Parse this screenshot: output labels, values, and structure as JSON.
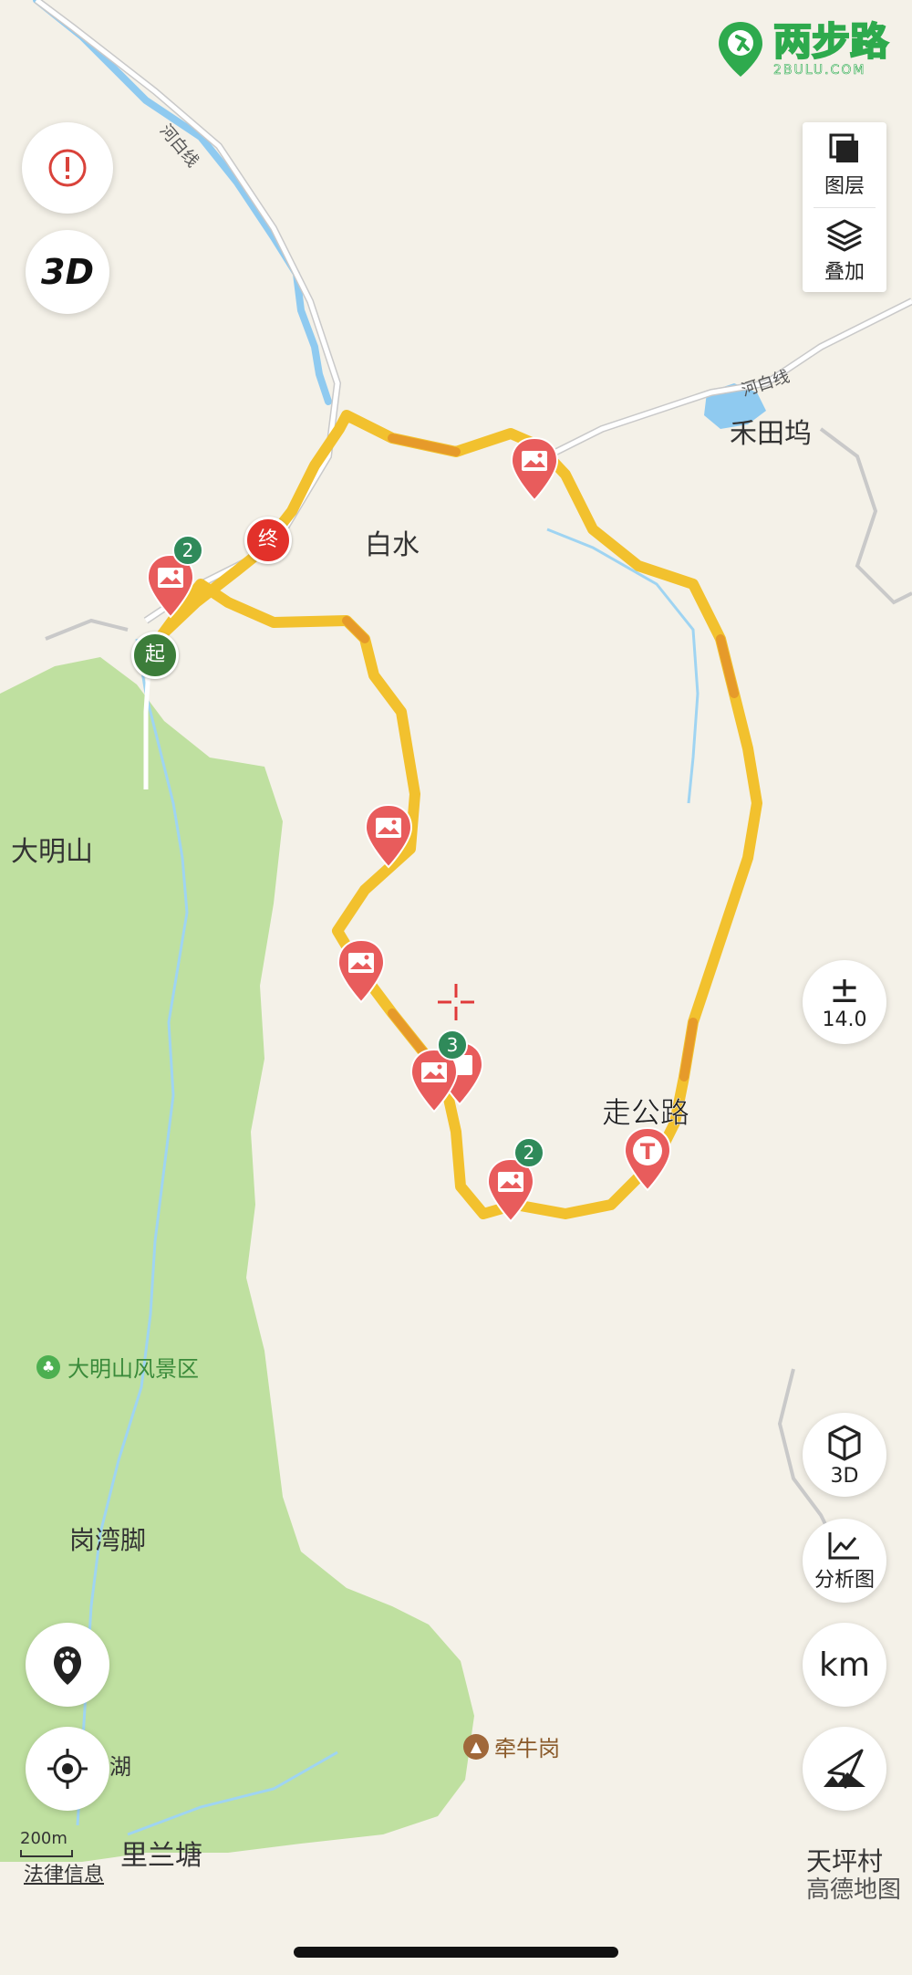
{
  "brand": {
    "name": "两步路",
    "sub": "2BULU.COM",
    "color": "#2eaa4d"
  },
  "controls": {
    "alert": {
      "icon": "alert-icon"
    },
    "threeD_top": {
      "label": "3D"
    },
    "layers": {
      "label": "图层"
    },
    "overlay": {
      "label": "叠加"
    },
    "zoom": {
      "value": "14.0"
    },
    "cube3d": {
      "label": "3D"
    },
    "analysis": {
      "label": "分析图"
    },
    "unit": {
      "label": "km"
    },
    "footprint": {
      "icon": "footprint-icon"
    },
    "locate": {
      "icon": "locate-icon"
    },
    "compass": {
      "icon": "compass-icon"
    }
  },
  "places": {
    "baishui": "白水",
    "hetianwu": "禾田坞",
    "damingshan": "大明山",
    "damingshan_scenic": "大明山风景区",
    "gangwanjiao": "岗湾脚",
    "qianniugang": "牵牛岗",
    "lilantang": "里兰塘",
    "hu": "湖",
    "tianpingcun": "天坪村",
    "zougonglu": "走公路"
  },
  "roads": {
    "hebai_1": "河白线",
    "hebai_2": "河白线"
  },
  "markers": {
    "start": "起",
    "end": "终",
    "badge_a": "2",
    "badge_b": "3",
    "badge_c": "2",
    "toll": "T"
  },
  "scale": {
    "value": "200m"
  },
  "legal": "法律信息",
  "provider": "高德地图",
  "colors": {
    "green_area": "#bfe0a0",
    "river": "#8fcaf0",
    "track": "#f2c12e",
    "pin": "#e85c5c",
    "start": "#3c7d3a",
    "end": "#e2312a"
  }
}
